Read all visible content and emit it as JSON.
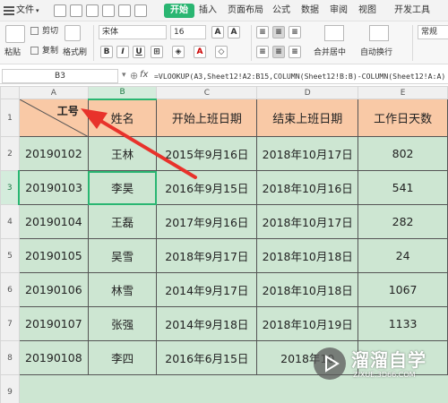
{
  "menubar": {
    "file": "文件",
    "tabs": [
      "开始",
      "插入",
      "页面布局",
      "公式",
      "数据",
      "审阅",
      "视图",
      "开发工具"
    ],
    "active_tab": "开始"
  },
  "ribbon": {
    "paste": "粘贴",
    "cut": "剪切",
    "copy": "复制",
    "format_painter": "格式刷",
    "font_name": "宋体",
    "font_size": "16",
    "merge_center": "合并居中",
    "wrap_text": "自动换行",
    "number_format": "常规"
  },
  "formula_bar": {
    "cell_ref": "B3",
    "fx": "fx",
    "formula": "=VLOOKUP(A3,Sheet12!A2:B15,COLUMN(Sheet12!B:B)-COLUMN(Sheet12!A:A)"
  },
  "sheet": {
    "columns": [
      "A",
      "B",
      "C",
      "D",
      "E"
    ],
    "rows": [
      "1",
      "2",
      "3",
      "4",
      "5",
      "6",
      "7",
      "8",
      "9"
    ],
    "header": {
      "id": "工号",
      "name": "姓名",
      "start": "开始上班日期",
      "end": "结束上班日期",
      "days": "工作日天数"
    },
    "data": [
      [
        "20190102",
        "王林",
        "2015年9月16日",
        "2018年10月17日",
        "802"
      ],
      [
        "20190103",
        "李昊",
        "2016年9月15日",
        "2018年10月16日",
        "541"
      ],
      [
        "20190104",
        "王磊",
        "2017年9月16日",
        "2018年10月17日",
        "282"
      ],
      [
        "20190105",
        "吴雪",
        "2018年9月17日",
        "2018年10月18日",
        "24"
      ],
      [
        "20190106",
        "林雪",
        "2014年9月17日",
        "2018年10月18日",
        "1067"
      ],
      [
        "20190107",
        "张强",
        "2014年9月18日",
        "2018年10月19日",
        "1133"
      ],
      [
        "20190108",
        "李四",
        "2016年6月15日",
        "2018年10",
        ""
      ]
    ]
  },
  "watermark": {
    "text": "溜溜自学",
    "sub": "ZIXUE.3D66.COM"
  },
  "colors": {
    "accent": "#2ab672",
    "header_fill": "#f9c9a6",
    "body_fill": "#cde6d2",
    "arrow": "#e8322b"
  }
}
